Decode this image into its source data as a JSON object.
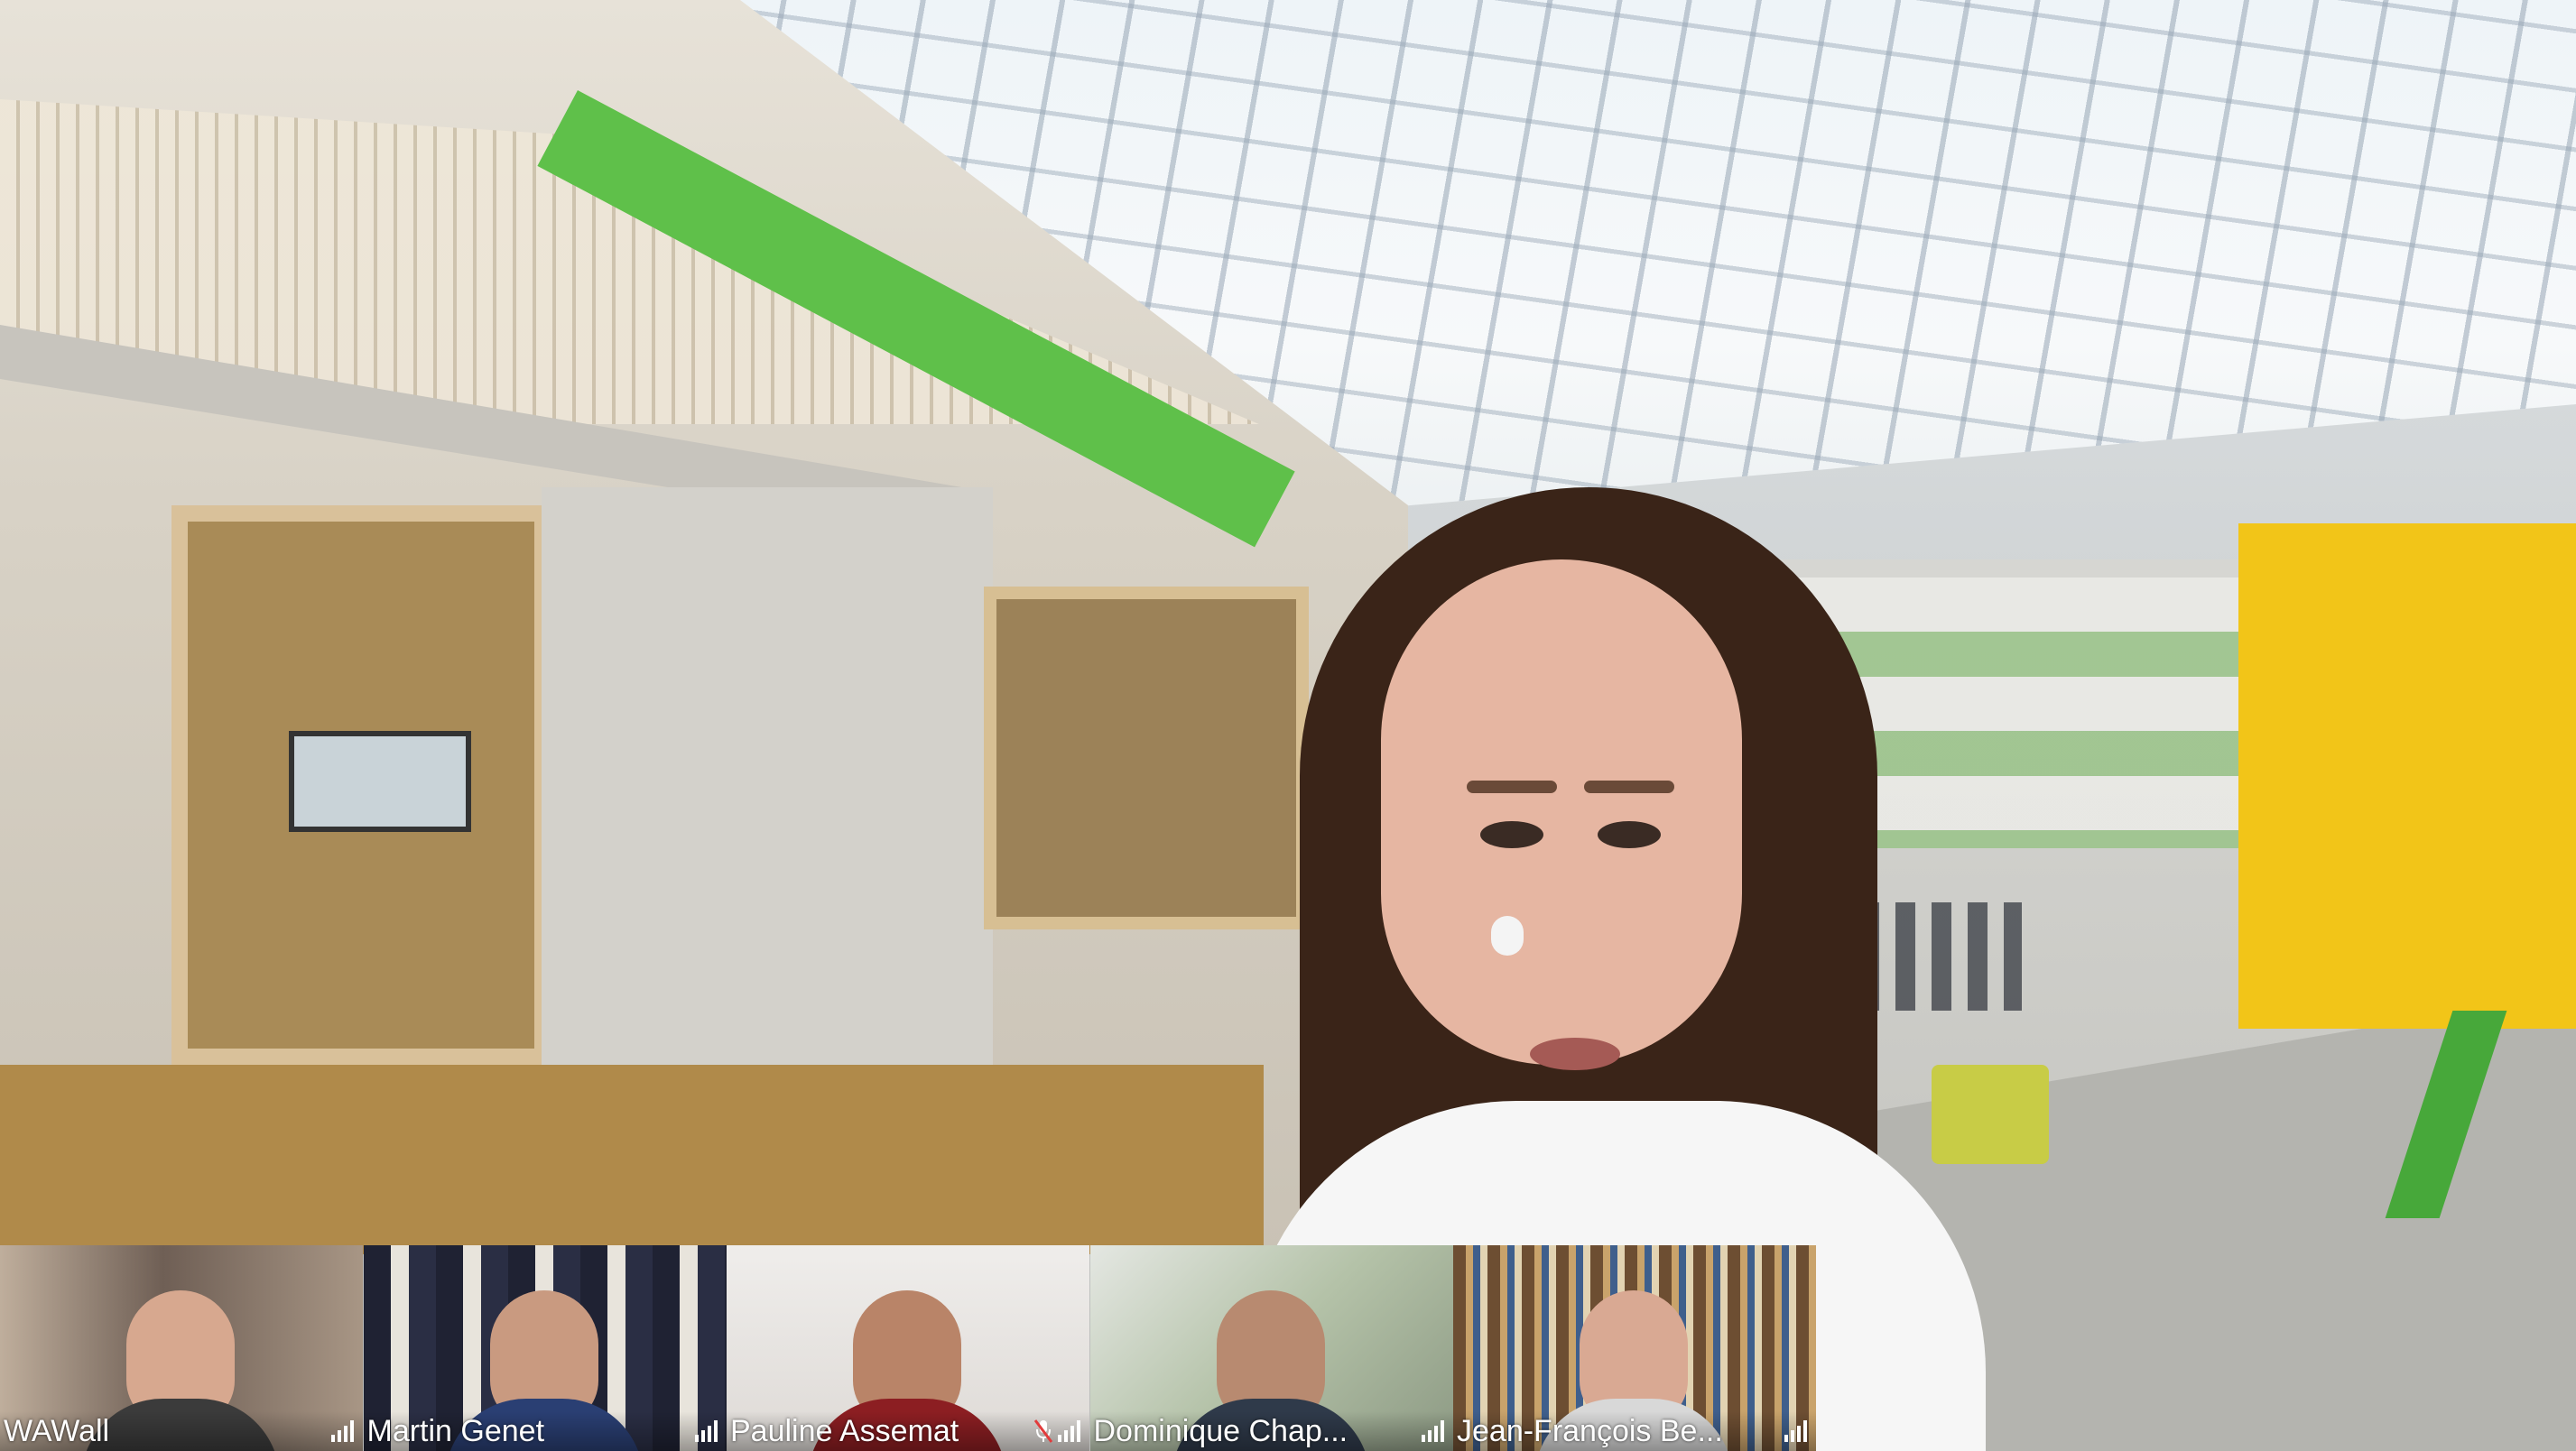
{
  "main_speaker": {
    "scene_icon": "presenter-video",
    "accent_colors": {
      "atrium_green": "#5fc04a",
      "atrium_yellow": "#f2c518"
    }
  },
  "participants": [
    {
      "name": "WAWall",
      "icon": "signal-icon",
      "muted": false,
      "tile_bg": "#8a7b70"
    },
    {
      "name": "Martin Genet",
      "icon": "signal-icon",
      "muted": false,
      "tile_bg": "#2e3346"
    },
    {
      "name": "Pauline Assemat",
      "icon": "signal-icon",
      "muted": true,
      "tile_bg": "#e6e3e0"
    },
    {
      "name": "Dominique  Chap...",
      "icon": "signal-icon",
      "muted": false,
      "tile_bg": "#c7cbc4"
    },
    {
      "name": "Jean-François Be...",
      "icon": "signal-icon",
      "muted": false,
      "tile_bg": "#8b6d4c"
    }
  ]
}
